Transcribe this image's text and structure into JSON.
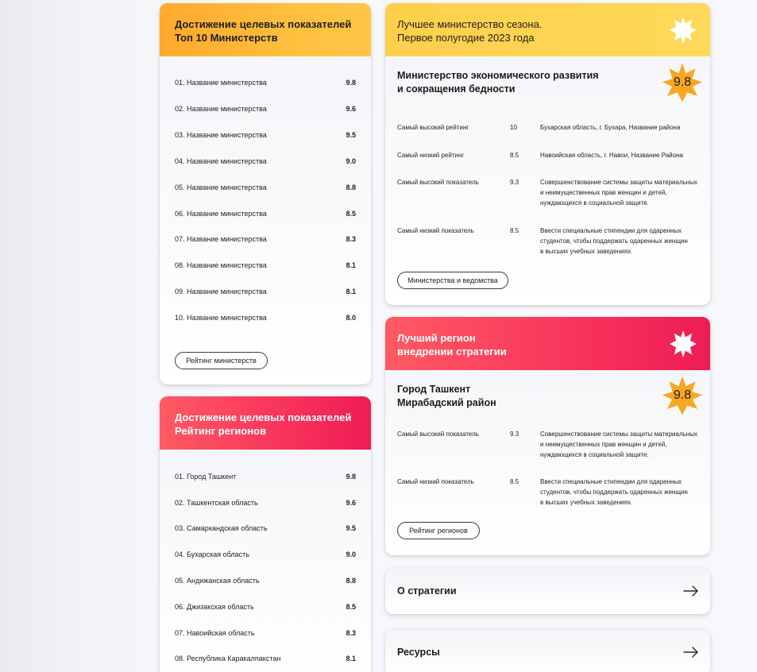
{
  "ministries_card": {
    "title_line1": "Достижение целевых показателей",
    "title_line2": "Топ 10 Министерств",
    "rows": [
      {
        "name": "01. Название министерства",
        "value": "9.8"
      },
      {
        "name": "02. Название министерства",
        "value": "9.6"
      },
      {
        "name": "03. Название министерства",
        "value": "9.5"
      },
      {
        "name": "04. Название министерства",
        "value": "9.0"
      },
      {
        "name": "05. Название министерства",
        "value": "8.8"
      },
      {
        "name": "06. Название министерства",
        "value": "8.5"
      },
      {
        "name": "07. Название министерства",
        "value": "8.3"
      },
      {
        "name": "08. Название министерства",
        "value": "8.1"
      },
      {
        "name": "09. Название министерства",
        "value": "8.1"
      },
      {
        "name": "10. Название министерства",
        "value": "8.0"
      }
    ],
    "button": "Рейтинг министерств"
  },
  "regions_card": {
    "title_line1": "Достижение целевых показателей",
    "title_line2": "Рейтинг регионов",
    "rows": [
      {
        "name": "01. Город Ташкент",
        "value": "9.8"
      },
      {
        "name": "02. Ташкентская область",
        "value": "9.6"
      },
      {
        "name": "03. Самаркандская область",
        "value": "9.5"
      },
      {
        "name": "04. Бухарская область",
        "value": "9.0"
      },
      {
        "name": "05. Андижанская область",
        "value": "8.8"
      },
      {
        "name": "06. Джизакская область",
        "value": "8.5"
      },
      {
        "name": "07. Навоийская область",
        "value": "8.3"
      },
      {
        "name": "08. Республика Каракалпакстан",
        "value": "8.1"
      }
    ]
  },
  "best_ministry_card": {
    "title_line1": "Лучшее министерство сезона.",
    "title_line2": "Первое полугодие 2023 года",
    "name_line1": "Министерство экономического развития",
    "name_line2": "и сокращения бедности",
    "score": "9.8",
    "metrics": [
      {
        "label": "Самый высокий рейтинг",
        "value": "10",
        "desc": "Бухарская область, г. Бухара, Название района"
      },
      {
        "label": "Самый низкий рейтинг",
        "value": "8.5",
        "desc": "Навоийская область, г. Навои, Название Района"
      },
      {
        "label": "Самый высокий показатель",
        "value": "9.3",
        "desc_lines": [
          "Совершенствование системы защиты материальных",
          "и неимущественных прав женщин и детей,",
          "нуждающихся в социальной защите."
        ]
      },
      {
        "label": "Самый низкий показатель",
        "value": "8.5",
        "desc_lines": [
          "Ввести специальные стипендии для одаренных",
          "студентов, чтобы поддержать одаренных женщин",
          "в высших учебных заведениях."
        ]
      }
    ],
    "button": "Министерства и ведомства"
  },
  "best_region_card": {
    "title_line1": "Лучший регион",
    "title_line2": "внедрении стратегии",
    "name_line1": "Город Ташкент",
    "name_line2": "Мирабадский район",
    "score": "9.8",
    "metrics": [
      {
        "label": "Самый высокий показатель",
        "value": "9.3",
        "desc_lines": [
          "Совершенствование системы защиты материальных",
          "и неимущественных прав женщин и детей,",
          "нуждающихся в социальной защите."
        ]
      },
      {
        "label": "Самый низкий показатель",
        "value": "8.5",
        "desc_lines": [
          "Ввести специальные стипендии для одаренных",
          "студентов, чтобы поддержать одаренных женщин",
          "в высших учебных заведениях."
        ]
      }
    ],
    "button": "Рейтинг регионов"
  },
  "nav": {
    "strategy": "О стратегии",
    "resources": "Ресурсы"
  },
  "colors": {
    "orange": "#ffaa2c",
    "yellow": "#ffd24f",
    "red": "#f0245a",
    "star": "#f7a823"
  },
  "icons": {
    "score_badge": "star-badge-icon",
    "header_burst": "burst-icon",
    "nav_arrow": "arrow-right-icon"
  }
}
